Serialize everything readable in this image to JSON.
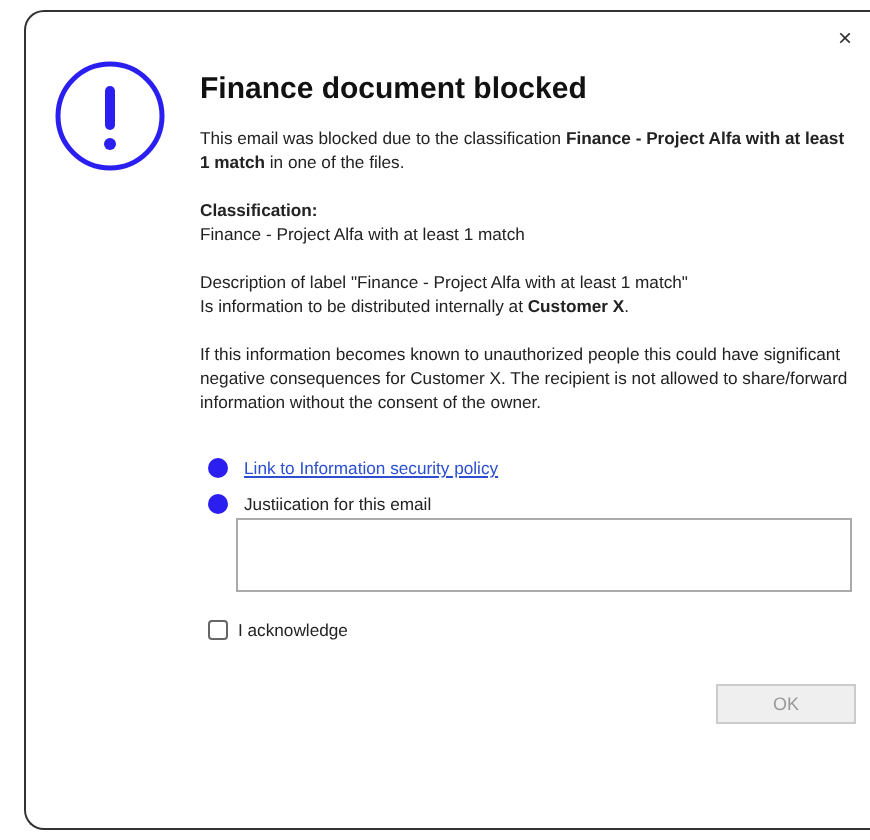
{
  "dialog": {
    "close": "×",
    "title": "Finance document blocked",
    "paragraphs": [
      {
        "kind": "text",
        "text": "This email was blocked due to the classification **Finance - Project Alfa with at least 1 match** in one of the files."
      },
      {
        "kind": "labeled",
        "label": "Classification:",
        "text": "Finance - Project Alfa with at least 1 match"
      },
      {
        "kind": "text",
        "text": "Description of label \"Finance - Project Alfa with at least 1 match\"\nIs information to be distributed internally at **Customer X**."
      },
      {
        "kind": "text",
        "text": "If this information becomes known to unauthorized people this could have significant negative consequences for Customer X. The recipient is not allowed to share/forward information without the consent of the owner."
      }
    ],
    "link": "Link to Information security policy",
    "justification": {
      "label": "Justiication for this email"
    },
    "acknowledge": {
      "label": "I acknowledge",
      "checked": false
    },
    "ok_button": {
      "label": "OK",
      "disabled": true
    }
  }
}
